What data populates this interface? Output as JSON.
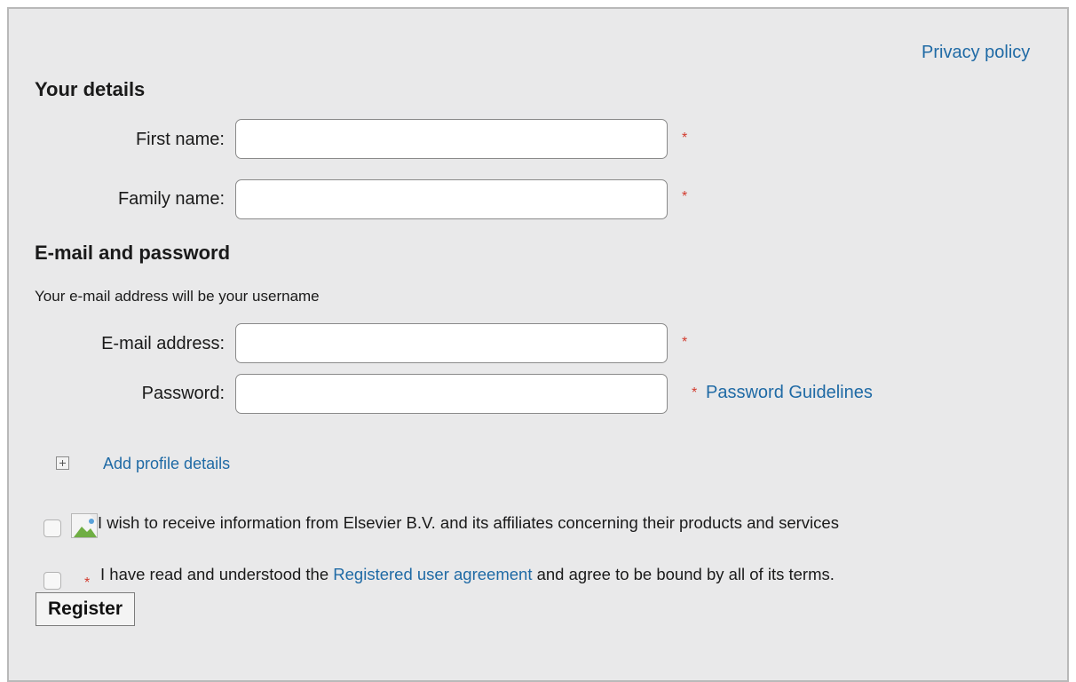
{
  "privacy_link": "Privacy policy",
  "your_details": {
    "title": "Your details",
    "first_name_label": "First name:",
    "first_name_value": "",
    "family_name_label": "Family name:",
    "family_name_value": ""
  },
  "email_password": {
    "title": "E-mail and password",
    "note": "Your e-mail address will be your username",
    "email_label": "E-mail address:",
    "email_value": "",
    "password_label": "Password:",
    "password_value": "",
    "password_guidelines_link": "Password Guidelines"
  },
  "required_marker": "*",
  "add_profile_details": "Add profile details",
  "marketing_checkbox": {
    "checked": false,
    "text": "I wish to receive information from Elsevier B.V. and its affiliates concerning their products and services"
  },
  "agreement_checkbox": {
    "checked": false,
    "text_before": "I have read and understood the ",
    "link": "Registered user agreement",
    "text_after": " and agree to be bound by all of its terms."
  },
  "register_button": "Register",
  "colors": {
    "panel_background": "#e9e9ea",
    "link": "#1f6aa5",
    "required": "#d23b2e"
  },
  "icons": {
    "expand": "plus-box-icon",
    "broken_image": "broken-image-icon"
  }
}
